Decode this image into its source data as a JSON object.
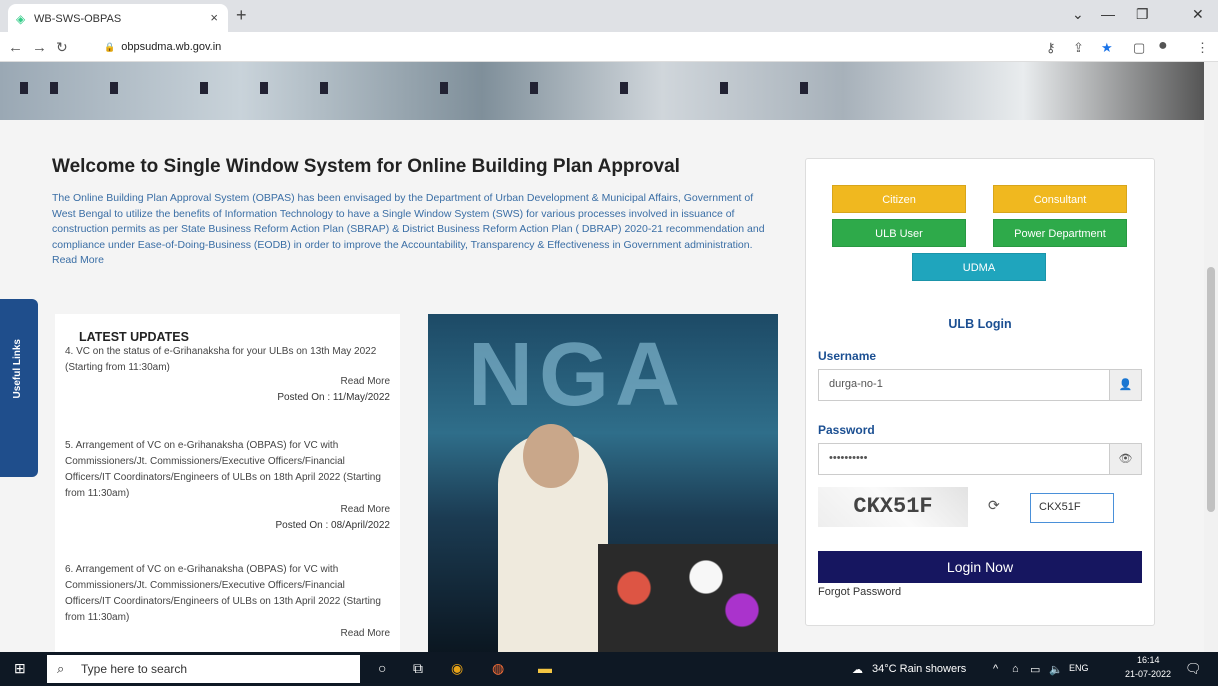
{
  "browser": {
    "tab_title": "WB-SWS-OBPAS",
    "url": "obpsudma.wb.gov.in",
    "close": "×",
    "newtab": "+"
  },
  "page": {
    "heading": "Welcome to Single Window System for Online Building Plan Approval",
    "intro": "The Online Building Plan Approval System (OBPAS) has been envisaged by the Department of Urban Development & Municipal Affairs, Government of West Bengal to utilize the benefits of Information Technology to have a Single Window System (SWS) for various processes involved in issuance of construction permits as per State Business Reform Action Plan (SBRAP) & District Business Reform Action Plan ( DBRAP) 2020-21 recommendation and compliance under Ease-of-Doing-Business (EODB) in order to improve the Accountability, Transparency & Effectiveness in Government administration. Read More",
    "useful_links": "Useful Links",
    "updates": {
      "title": "LATEST UPDATES",
      "items": [
        {
          "text": "4. VC on the status of e-Grihanaksha for your ULBs on 13th May 2022 (Starting from 11:30am)",
          "more": "Read More",
          "posted": "Posted On : 11/May/2022"
        },
        {
          "text": "5. Arrangement of VC on e-Grihanaksha (OBPAS) for VC with Commissioners/Jt. Commissioners/Executive Officers/Financial Officers/IT Coordinators/Engineers of ULBs on 18th April 2022 (Starting from 11:30am)",
          "more": "Read More",
          "posted": "Posted On : 08/April/2022"
        },
        {
          "text": "6. Arrangement of VC on e-Grihanaksha (OBPAS) for VC with Commissioners/Jt. Commissioners/Executive Officers/Financial Officers/IT Coordinators/Engineers of ULBs on 13th April 2022 (Starting from 11:30am)",
          "more": "Read More"
        }
      ]
    },
    "login": {
      "buttons": {
        "citizen": "Citizen",
        "consultant": "Consultant",
        "ulb_user": "ULB User",
        "power": "Power Department",
        "udma": "UDMA"
      },
      "title": "ULB Login",
      "username_label": "Username",
      "username_value": "durga-no-1",
      "password_label": "Password",
      "password_value": "••••••••••",
      "captcha_text": "CKX51F",
      "captcha_input": "CKX51F",
      "login_button": "Login Now",
      "forgot": "Forgot Password"
    }
  },
  "taskbar": {
    "search": "Type here to search",
    "weather": "34°C Rain showers",
    "lang": "ENG",
    "time": "16:14",
    "date": "21-07-2022"
  }
}
